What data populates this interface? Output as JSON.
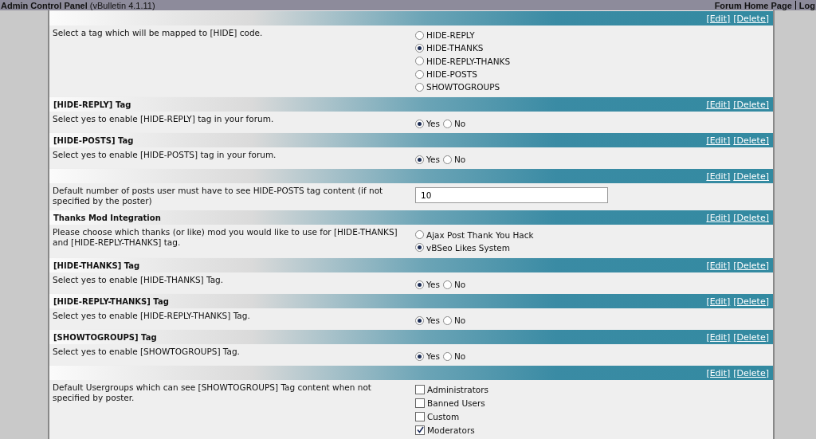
{
  "top_bar": {
    "title": "Admin Control Panel",
    "version": "(vBulletin 4.1.11)",
    "links": [
      "Forum Home Page",
      "Log"
    ]
  },
  "sections": [
    {
      "actions": [
        "[Edit]",
        "[Delete]"
      ],
      "description": "Select a tag which will be mapped to [HIDE] code.",
      "kind": "radio",
      "options": [
        {
          "label": "HIDE-REPLY",
          "selected": false
        },
        {
          "label": "HIDE-THANKS",
          "selected": true
        },
        {
          "label": "HIDE-REPLY-THANKS",
          "selected": false
        },
        {
          "label": "HIDE-POSTS",
          "selected": false
        },
        {
          "label": "SHOWTOGROUPS",
          "selected": false
        }
      ]
    },
    {
      "title": "[HIDE-REPLY] Tag",
      "actions": [
        "[Edit]",
        "[Delete]"
      ],
      "description": "Select yes to enable [HIDE-REPLY] tag in your forum.",
      "kind": "yesno",
      "options": [
        {
          "label": "Yes",
          "selected": true
        },
        {
          "label": "No",
          "selected": false
        }
      ]
    },
    {
      "title": "[HIDE-POSTS] Tag",
      "actions": [
        "[Edit]",
        "[Delete]"
      ],
      "description": "Select yes to enable [HIDE-POSTS] tag in your forum.",
      "kind": "yesno",
      "options": [
        {
          "label": "Yes",
          "selected": true
        },
        {
          "label": "No",
          "selected": false
        }
      ]
    },
    {
      "actions": [
        "[Edit]",
        "[Delete]"
      ],
      "description": "Default number of posts user must have to see HIDE-POSTS tag content (if not specified by the poster)",
      "kind": "text",
      "value": "10"
    },
    {
      "title": "Thanks Mod Integration",
      "actions": [
        "[Edit]",
        "[Delete]"
      ],
      "description": "Please choose which thanks (or like) mod you would like to use for [HIDE-THANKS] and [HIDE-REPLY-THANKS] tag.",
      "kind": "radio",
      "options": [
        {
          "label": "Ajax Post Thank You Hack",
          "selected": false
        },
        {
          "label": "vBSeo Likes System",
          "selected": true
        }
      ]
    },
    {
      "title": "[HIDE-THANKS] Tag",
      "actions": [
        "[Edit]",
        "[Delete]"
      ],
      "description": "Select yes to enable [HIDE-THANKS] Tag.",
      "kind": "yesno",
      "options": [
        {
          "label": "Yes",
          "selected": true
        },
        {
          "label": "No",
          "selected": false
        }
      ]
    },
    {
      "title": "[HIDE-REPLY-THANKS] Tag",
      "actions": [
        "[Edit]",
        "[Delete]"
      ],
      "description": "Select yes to enable [HIDE-REPLY-THANKS] Tag.",
      "kind": "yesno",
      "options": [
        {
          "label": "Yes",
          "selected": true
        },
        {
          "label": "No",
          "selected": false
        }
      ]
    },
    {
      "title": "[SHOWTOGROUPS] Tag",
      "actions": [
        "[Edit]",
        "[Delete]"
      ],
      "description": "Select yes to enable [SHOWTOGROUPS] Tag.",
      "kind": "yesno",
      "options": [
        {
          "label": "Yes",
          "selected": true
        },
        {
          "label": "No",
          "selected": false
        }
      ]
    },
    {
      "actions": [
        "[Edit]",
        "[Delete]"
      ],
      "description": "Default Usergroups which can see [SHOWTOGROUPS] Tag content when not specified by poster.",
      "kind": "checkbox",
      "options": [
        {
          "label": "Administrators",
          "checked": false
        },
        {
          "label": "Banned Users",
          "checked": false
        },
        {
          "label": "Custom",
          "checked": false
        },
        {
          "label": "Moderators",
          "checked": true
        }
      ]
    }
  ]
}
